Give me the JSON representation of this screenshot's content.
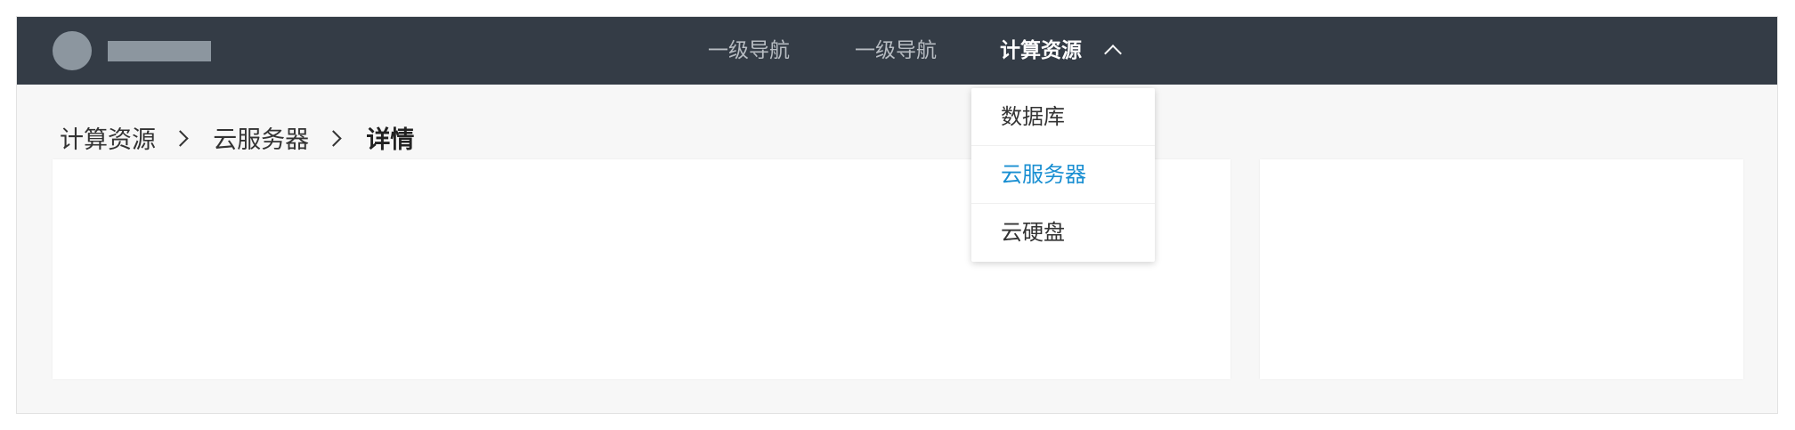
{
  "header": {
    "nav": [
      {
        "label": "一级导航"
      },
      {
        "label": "一级导航"
      },
      {
        "label": "计算资源",
        "active": true
      }
    ]
  },
  "dropdown": {
    "items": [
      {
        "label": "数据库"
      },
      {
        "label": "云服务器",
        "selected": true
      },
      {
        "label": "云硬盘"
      }
    ]
  },
  "breadcrumb": {
    "items": [
      "计算资源",
      "云服务器"
    ],
    "current": "详情"
  },
  "colors": {
    "topbar": "#343c46",
    "placeholder": "#8c969f",
    "accent": "#1a8fd2",
    "page_bg": "#f7f7f7"
  },
  "icons": {
    "nav_expand": "chevron-up-icon",
    "breadcrumb_separator": "chevron-right-icon"
  }
}
